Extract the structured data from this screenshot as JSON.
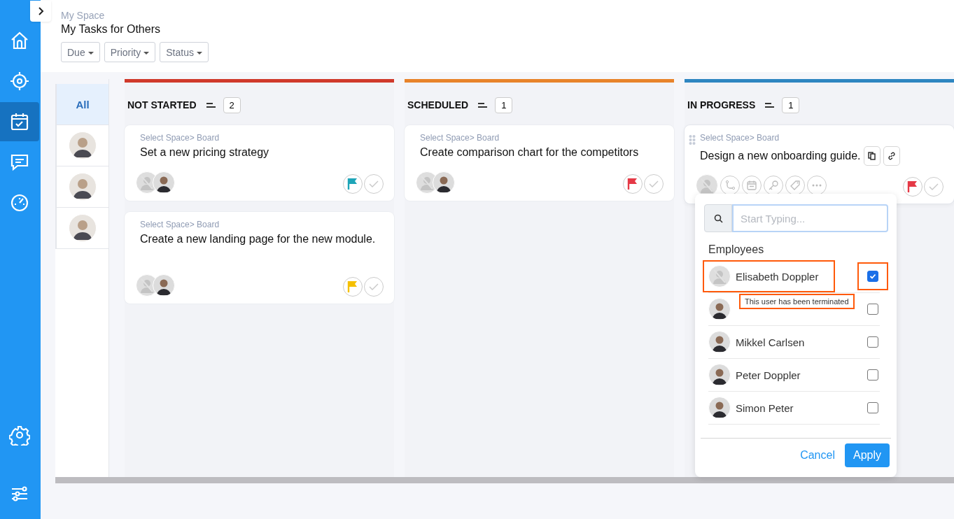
{
  "sidebar": {
    "items": [
      {
        "kind": "home",
        "selected": false
      },
      {
        "kind": "target",
        "selected": false
      },
      {
        "kind": "calendar",
        "selected": true
      },
      {
        "kind": "chat",
        "selected": false
      },
      {
        "kind": "gauge",
        "selected": false
      }
    ],
    "bottom_items": [
      {
        "kind": "gear",
        "selected": false
      },
      {
        "kind": "sliders",
        "selected": false
      }
    ]
  },
  "header": {
    "breadcrumb": "My Space",
    "title": "My Tasks for Others",
    "filters": [
      {
        "label": "Due"
      },
      {
        "label": "Priority"
      },
      {
        "label": "Status"
      }
    ]
  },
  "people_filter": [
    {
      "kind": "all",
      "label": "All",
      "selected": true
    },
    {
      "kind": "avatar",
      "selected": false
    },
    {
      "kind": "avatar",
      "selected": false
    },
    {
      "kind": "avatar",
      "selected": false
    }
  ],
  "columns": [
    {
      "title": "NOT STARTED",
      "count": "2",
      "color": "#d0392b",
      "cards": [
        {
          "path": "Select Space> Board",
          "title": "Set a new pricing strategy",
          "hovered": false,
          "assignees": [
            {
              "terminated": true
            },
            {
              "terminated": false
            }
          ],
          "color": "#1ea5b8"
        },
        {
          "path": "Select Space> Board",
          "title": "Create a new landing page for the new module.",
          "hovered": false,
          "assignees": [
            {
              "terminated": true
            },
            {
              "terminated": false
            }
          ],
          "color": "#f5c000"
        }
      ]
    },
    {
      "title": "SCHEDULED",
      "count": "1",
      "color": "#e8832a",
      "cards": [
        {
          "path": "Select Space> Board",
          "title": "Create comparison chart for the competitors",
          "hovered": false,
          "assignees": [
            {
              "terminated": true
            },
            {
              "terminated": false
            }
          ],
          "color": "#e53946"
        }
      ]
    },
    {
      "title": "IN PROGRESS",
      "count": "1",
      "color": "#2e86c1",
      "cards": [
        {
          "path": "Select Space> Board",
          "title": "Design a new onboarding guide.",
          "hovered": true,
          "assignees": [
            {
              "terminated": true
            }
          ],
          "color": "#e53946"
        }
      ]
    }
  ],
  "assign_popup": {
    "search_placeholder": "Start Typing...",
    "section": "Employees",
    "tooltip": "This user has been terminated",
    "employees": [
      {
        "name": "Elisabeth Doppler",
        "terminated": true,
        "checked": true,
        "highlighted": true
      },
      {
        "terminated": false,
        "checked": false,
        "highlighted": false
      },
      {
        "name": "Mikkel Carlsen",
        "terminated": false,
        "checked": false,
        "highlighted": false
      },
      {
        "name": "Peter Doppler",
        "terminated": false,
        "checked": false,
        "highlighted": false
      },
      {
        "name": "Simon Peter",
        "terminated": false,
        "checked": false,
        "highlighted": false
      }
    ],
    "cancel": "Cancel",
    "apply": "Apply"
  }
}
